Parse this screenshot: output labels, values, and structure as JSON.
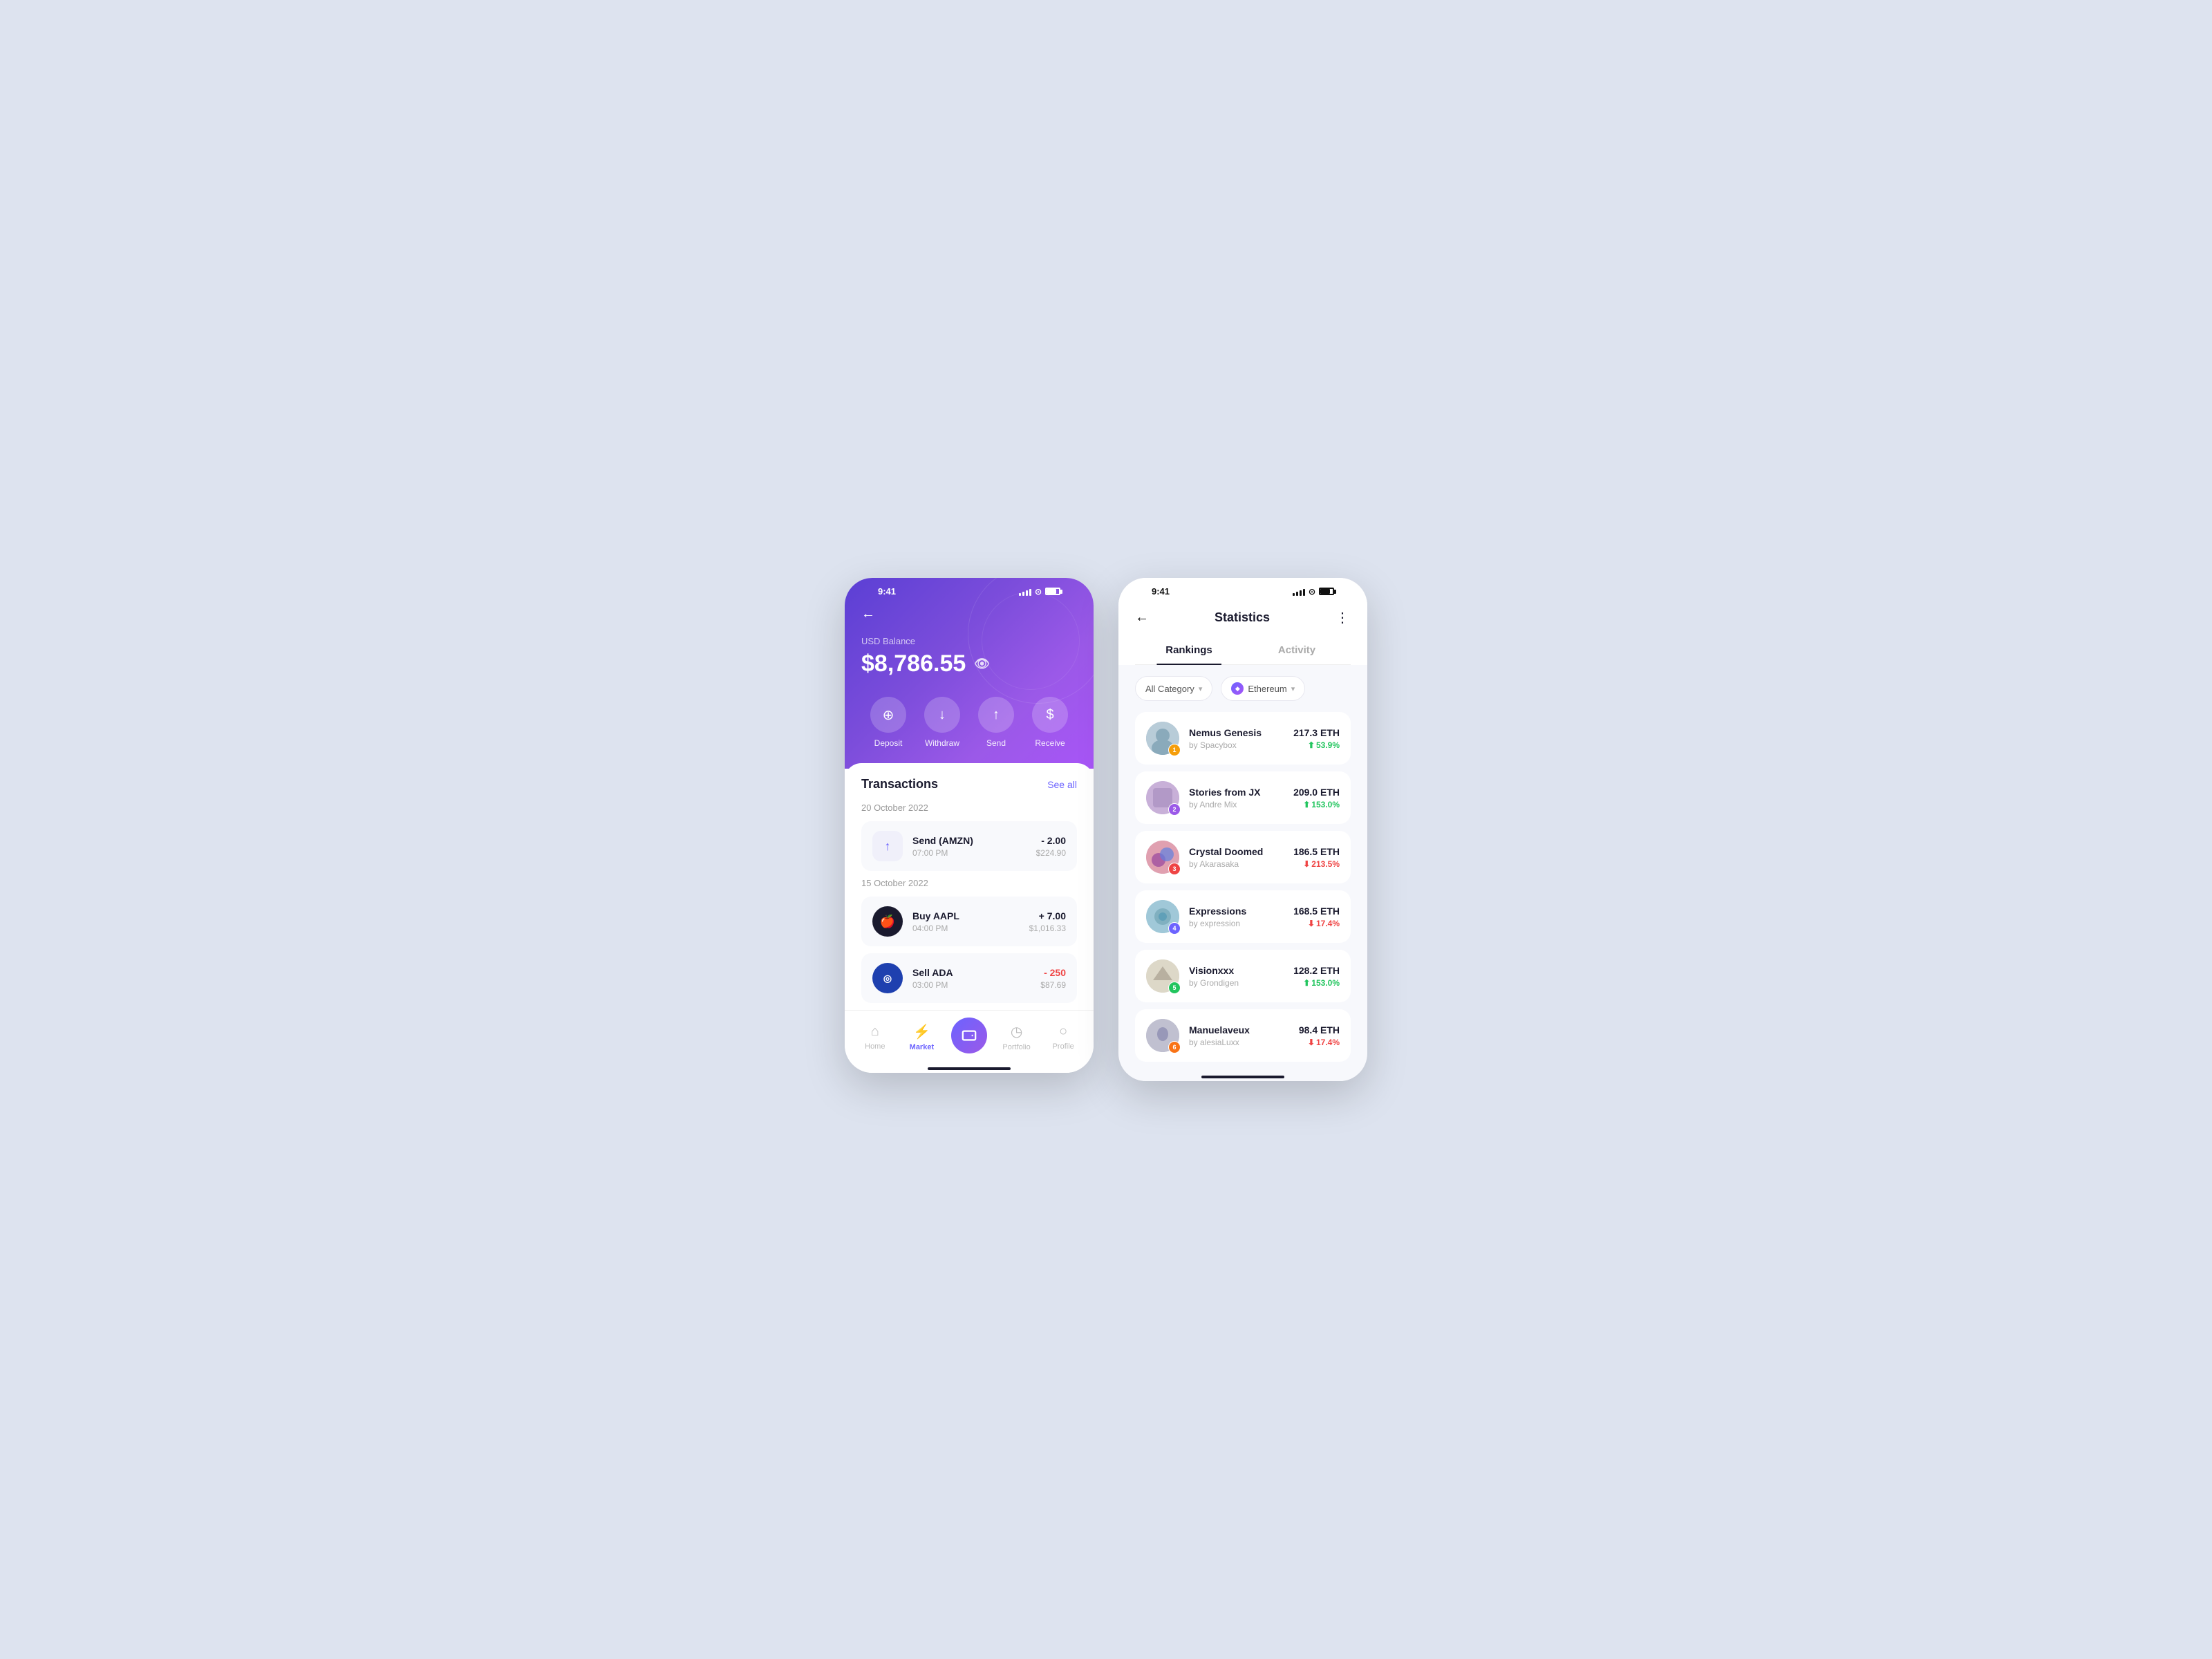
{
  "phone1": {
    "statusBar": {
      "time": "9:41"
    },
    "header": {
      "back": "←",
      "balanceLabel": "USD Balance",
      "balance": "$8,786.55"
    },
    "actions": [
      {
        "id": "deposit",
        "label": "Deposit",
        "icon": "⊕"
      },
      {
        "id": "withdraw",
        "label": "Withdraw",
        "icon": "⊖"
      },
      {
        "id": "send",
        "label": "Send",
        "icon": "↑"
      },
      {
        "id": "receive",
        "label": "Receive",
        "icon": "$"
      }
    ],
    "transactions": {
      "title": "Transactions",
      "seeAll": "See all",
      "groups": [
        {
          "date": "20 October 2022",
          "items": [
            {
              "name": "Send (AMZN)",
              "time": "07:00 PM",
              "change": "- 2.00",
              "usd": "$224.90",
              "changeType": "neutral",
              "iconType": "send"
            }
          ]
        },
        {
          "date": "15 October 2022",
          "items": [
            {
              "name": "Buy AAPL",
              "time": "04:00 PM",
              "change": "+ 7.00",
              "usd": "$1,016.33",
              "changeType": "positive",
              "iconType": "apple"
            },
            {
              "name": "Sell ADA",
              "time": "03:00 PM",
              "change": "- 250",
              "usd": "$87.69",
              "changeType": "negative",
              "iconType": "ada"
            }
          ]
        }
      ]
    },
    "nav": {
      "items": [
        {
          "id": "home",
          "label": "Home",
          "icon": "⌂",
          "active": false
        },
        {
          "id": "market",
          "label": "Market",
          "icon": "⚡",
          "active": true
        },
        {
          "id": "wallet",
          "label": "",
          "icon": "◉",
          "active": false,
          "center": true
        },
        {
          "id": "portfolio",
          "label": "Portfolio",
          "icon": "◷",
          "active": false
        },
        {
          "id": "profile",
          "label": "Profile",
          "icon": "○",
          "active": false
        }
      ]
    }
  },
  "phone2": {
    "statusBar": {
      "time": "9:41"
    },
    "header": {
      "back": "←",
      "title": "Statistics",
      "dots": "⋮"
    },
    "tabs": [
      {
        "id": "rankings",
        "label": "Rankings",
        "active": true
      },
      {
        "id": "activity",
        "label": "Activity",
        "active": false
      }
    ],
    "filters": {
      "category": {
        "label": "All Category",
        "icon": "▾"
      },
      "currency": {
        "label": "Ethereum",
        "icon": "▾"
      }
    },
    "rankings": [
      {
        "rank": 1,
        "name": "Nemus Genesis",
        "by": "by Spacybox",
        "eth": "217.3 ETH",
        "pct": "53.9%",
        "pctDir": "up",
        "avatarClass": "av-1",
        "badgeClass": "badge-1"
      },
      {
        "rank": 2,
        "name": "Stories from JX",
        "by": "by Andre Mix",
        "eth": "209.0 ETH",
        "pct": "153.0%",
        "pctDir": "up",
        "avatarClass": "av-2",
        "badgeClass": "badge-2"
      },
      {
        "rank": 3,
        "name": "Crystal Doomed",
        "by": "by Akarasaka",
        "eth": "186.5 ETH",
        "pct": "213.5%",
        "pctDir": "down",
        "avatarClass": "av-3",
        "badgeClass": "badge-3"
      },
      {
        "rank": 4,
        "name": "Expressions",
        "by": "by expression",
        "eth": "168.5 ETH",
        "pct": "17.4%",
        "pctDir": "down",
        "avatarClass": "av-4",
        "badgeClass": "badge-4"
      },
      {
        "rank": 5,
        "name": "Visionxxx",
        "by": "by Grondigen",
        "eth": "128.2 ETH",
        "pct": "153.0%",
        "pctDir": "up",
        "avatarClass": "av-5",
        "badgeClass": "badge-5"
      },
      {
        "rank": 6,
        "name": "Manuelaveux",
        "by": "by alesiaLuxx",
        "eth": "98.4 ETH",
        "pct": "17.4%",
        "pctDir": "down",
        "avatarClass": "av-6",
        "badgeClass": "badge-6"
      }
    ]
  }
}
